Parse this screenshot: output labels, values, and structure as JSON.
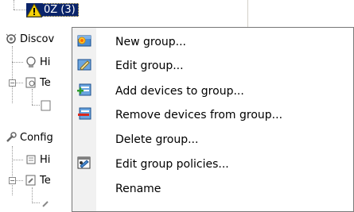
{
  "tree": {
    "selected_node_label": "0Z (3)",
    "nodes": [
      {
        "label": "Discov"
      },
      {
        "label": "Hi"
      },
      {
        "label": "Te"
      },
      {
        "label": "Config"
      },
      {
        "label": "Hi"
      },
      {
        "label": "Te"
      }
    ],
    "colors": {
      "selection": "#0a246a"
    }
  },
  "context_menu": {
    "items": [
      {
        "label": "New group...",
        "icon": "new-group-icon"
      },
      {
        "label": "Edit group...",
        "icon": "edit-group-icon"
      },
      {
        "label": "Add devices to group...",
        "icon": "add-devices-icon"
      },
      {
        "label": "Remove devices from group...",
        "icon": "remove-devices-icon"
      },
      {
        "label": "Delete group...",
        "icon": ""
      },
      {
        "label": "Edit group policies...",
        "icon": "group-policies-icon"
      },
      {
        "label": "Rename",
        "icon": ""
      }
    ]
  }
}
